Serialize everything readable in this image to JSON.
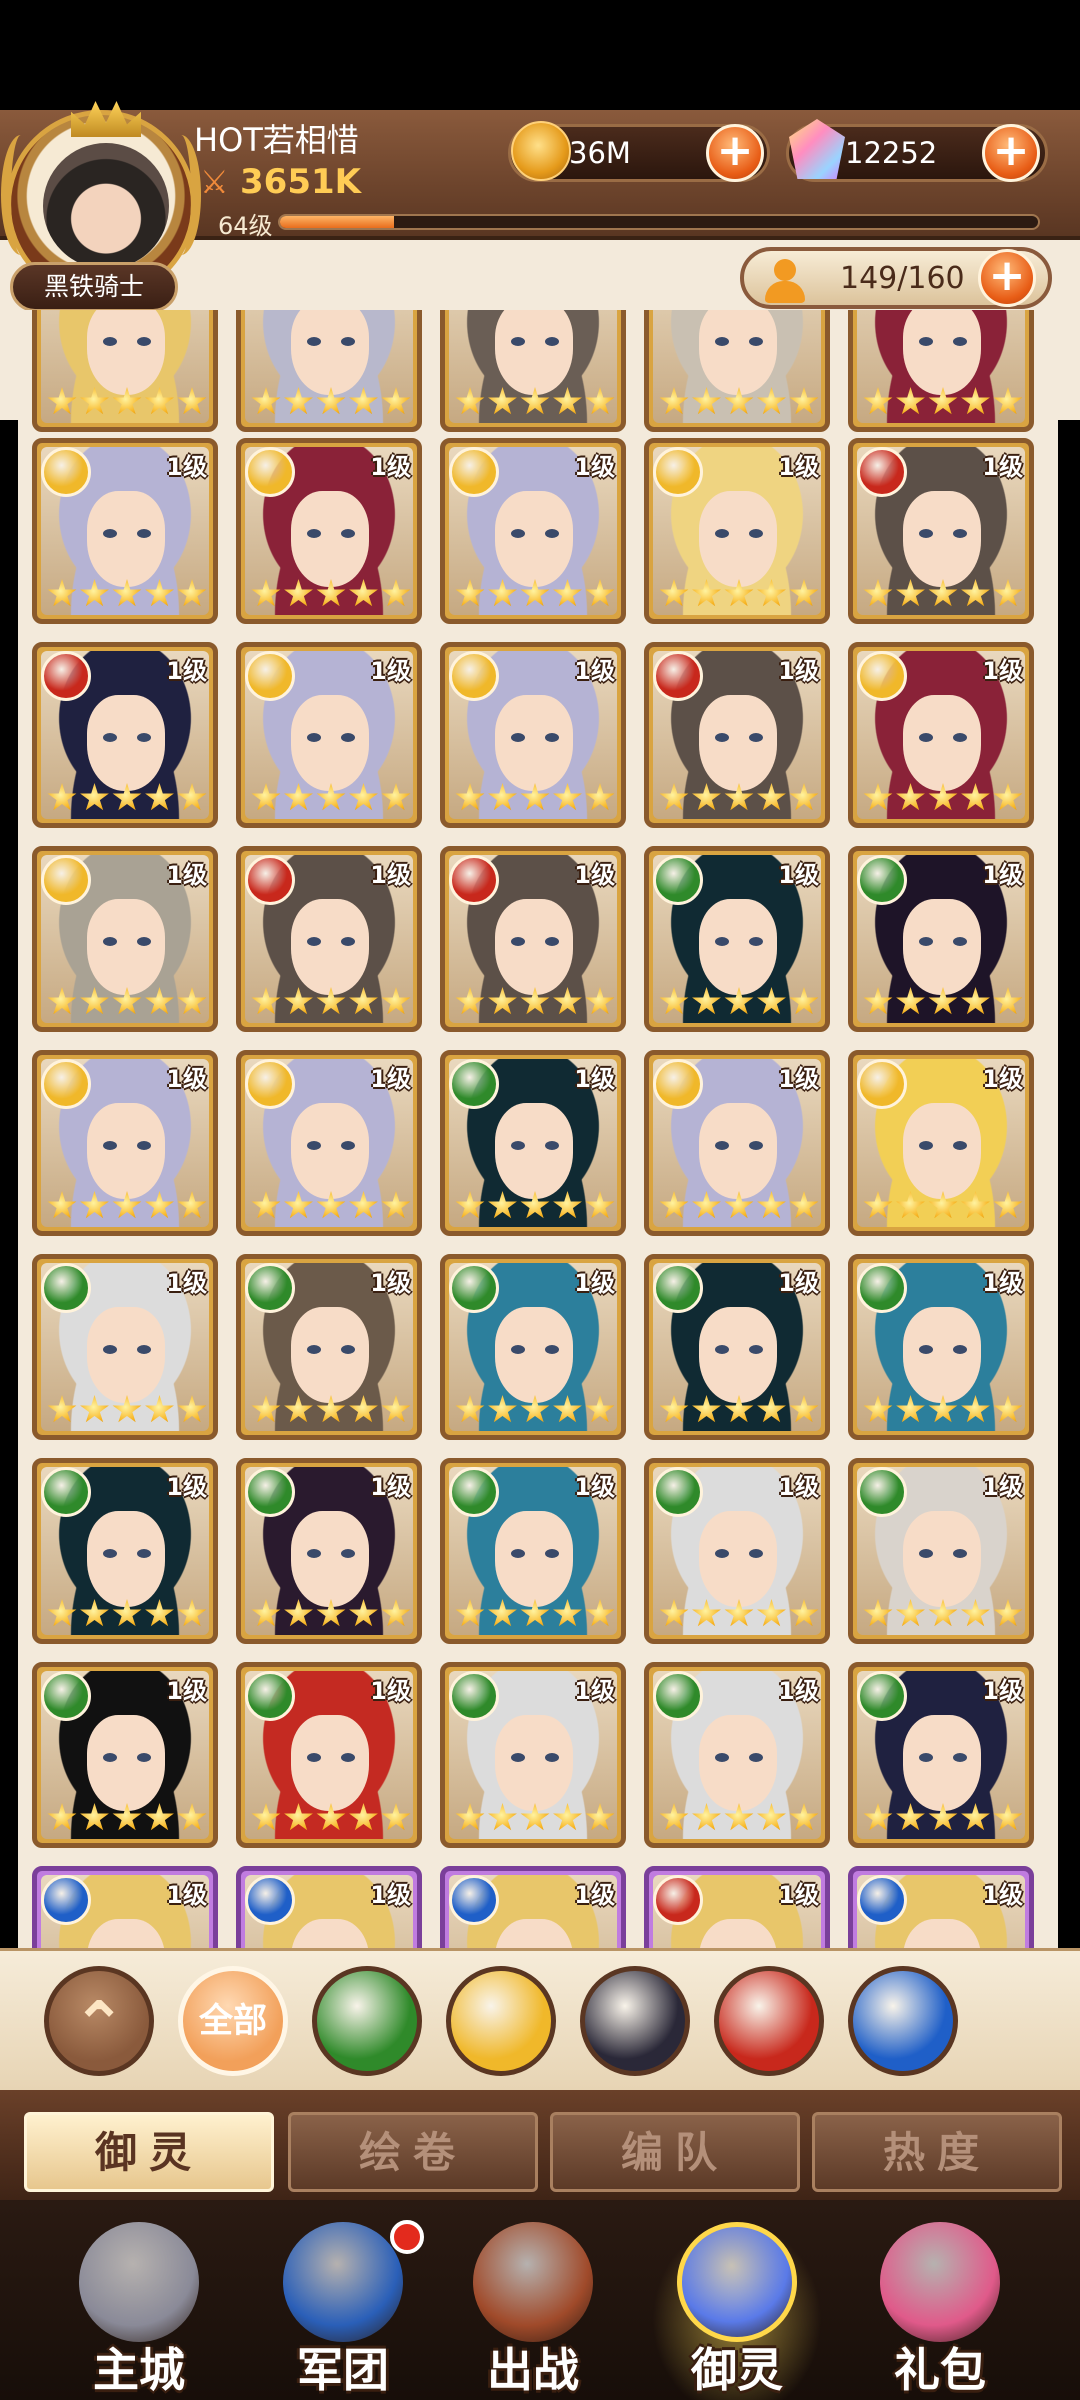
{
  "header": {
    "player_name": "HOT若相惜",
    "power": "3651K",
    "level": "64级",
    "xp_fraction": 0.15,
    "title_badge": "黑铁骑士",
    "gold": "36M",
    "gems": "12252",
    "roster": "149/160",
    "icons": {
      "power": "crossed-swords-icon",
      "gold": "gold-coin-icon",
      "gems": "crystal-gem-icon",
      "roster": "person-icon",
      "add": "plus-icon"
    }
  },
  "heroes": [
    {
      "row": 0,
      "col": 0,
      "faction": "",
      "level": "",
      "stars": 5,
      "partial": true,
      "hair": "#e8c66a"
    },
    {
      "row": 0,
      "col": 1,
      "faction": "",
      "level": "",
      "stars": 5,
      "partial": true,
      "hair": "#b8b8cc"
    },
    {
      "row": 0,
      "col": 2,
      "faction": "",
      "level": "",
      "stars": 5,
      "partial": true,
      "hair": "#6a5e55"
    },
    {
      "row": 0,
      "col": 3,
      "faction": "",
      "level": "",
      "stars": 5,
      "partial": true,
      "hair": "#c9c0b2"
    },
    {
      "row": 0,
      "col": 4,
      "faction": "",
      "level": "",
      "stars": 5,
      "partial": true,
      "hair": "#8a2238"
    },
    {
      "row": 1,
      "col": 0,
      "faction": "gold",
      "level": "1级",
      "stars": 5,
      "hair": "#b5b3d4"
    },
    {
      "row": 1,
      "col": 1,
      "faction": "gold",
      "level": "1级",
      "stars": 5,
      "hair": "#8a2238"
    },
    {
      "row": 1,
      "col": 2,
      "faction": "gold",
      "level": "1级",
      "stars": 5,
      "hair": "#b5b3d4"
    },
    {
      "row": 1,
      "col": 3,
      "faction": "gold",
      "level": "1级",
      "stars": 5,
      "hair": "#efd481"
    },
    {
      "row": 1,
      "col": 4,
      "faction": "red",
      "level": "1级",
      "stars": 5,
      "hair": "#5c5048"
    },
    {
      "row": 2,
      "col": 0,
      "faction": "red",
      "level": "1级",
      "stars": 5,
      "hair": "#1f2140"
    },
    {
      "row": 2,
      "col": 1,
      "faction": "gold",
      "level": "1级",
      "stars": 5,
      "hair": "#b5b3d4"
    },
    {
      "row": 2,
      "col": 2,
      "faction": "gold",
      "level": "1级",
      "stars": 5,
      "hair": "#b5b3d4"
    },
    {
      "row": 2,
      "col": 3,
      "faction": "red",
      "level": "1级",
      "stars": 5,
      "hair": "#5c5048"
    },
    {
      "row": 2,
      "col": 4,
      "faction": "gold",
      "level": "1级",
      "stars": 5,
      "hair": "#8a2238"
    },
    {
      "row": 3,
      "col": 0,
      "faction": "gold",
      "level": "1级",
      "stars": 5,
      "hair": "#a9a294"
    },
    {
      "row": 3,
      "col": 1,
      "faction": "red",
      "level": "1级",
      "stars": 5,
      "hair": "#5c5048"
    },
    {
      "row": 3,
      "col": 2,
      "faction": "red",
      "level": "1级",
      "stars": 5,
      "hair": "#5c5048"
    },
    {
      "row": 3,
      "col": 3,
      "faction": "green",
      "level": "1级",
      "stars": 5,
      "hair": "#102a33"
    },
    {
      "row": 3,
      "col": 4,
      "faction": "green",
      "level": "1级",
      "stars": 5,
      "hair": "#1e1428"
    },
    {
      "row": 4,
      "col": 0,
      "faction": "gold",
      "level": "1级",
      "stars": 5,
      "hair": "#b5b3d4"
    },
    {
      "row": 4,
      "col": 1,
      "faction": "gold",
      "level": "1级",
      "stars": 5,
      "hair": "#b5b3d4"
    },
    {
      "row": 4,
      "col": 2,
      "faction": "green",
      "level": "1级",
      "stars": 5,
      "hair": "#102a33"
    },
    {
      "row": 4,
      "col": 3,
      "faction": "gold",
      "level": "1级",
      "stars": 5,
      "hair": "#b5b3d4"
    },
    {
      "row": 4,
      "col": 4,
      "faction": "gold",
      "level": "1级",
      "stars": 5,
      "hair": "#f2cf55"
    },
    {
      "row": 5,
      "col": 0,
      "faction": "green",
      "level": "1级",
      "stars": 5,
      "hair": "#dcdcdc"
    },
    {
      "row": 5,
      "col": 1,
      "faction": "green",
      "level": "1级",
      "stars": 5,
      "hair": "#6b5a4a"
    },
    {
      "row": 5,
      "col": 2,
      "faction": "green",
      "level": "1级",
      "stars": 5,
      "hair": "#2c7f9c"
    },
    {
      "row": 5,
      "col": 3,
      "faction": "green",
      "level": "1级",
      "stars": 5,
      "hair": "#102a33"
    },
    {
      "row": 5,
      "col": 4,
      "faction": "green",
      "level": "1级",
      "stars": 5,
      "hair": "#2c7f9c"
    },
    {
      "row": 6,
      "col": 0,
      "faction": "green",
      "level": "1级",
      "stars": 5,
      "hair": "#102a33"
    },
    {
      "row": 6,
      "col": 1,
      "faction": "green",
      "level": "1级",
      "stars": 5,
      "hair": "#2a1a2e"
    },
    {
      "row": 6,
      "col": 2,
      "faction": "green",
      "level": "1级",
      "stars": 5,
      "hair": "#2c7f9c"
    },
    {
      "row": 6,
      "col": 3,
      "faction": "green",
      "level": "1级",
      "stars": 5,
      "hair": "#dcdcdc"
    },
    {
      "row": 6,
      "col": 4,
      "faction": "green",
      "level": "1级",
      "stars": 5,
      "hair": "#d9d3cc"
    },
    {
      "row": 7,
      "col": 0,
      "faction": "green",
      "level": "1级",
      "stars": 5,
      "hair": "#111111"
    },
    {
      "row": 7,
      "col": 1,
      "faction": "green",
      "level": "1级",
      "stars": 5,
      "hair": "#c42a22"
    },
    {
      "row": 7,
      "col": 2,
      "faction": "green",
      "level": "1级",
      "stars": 5,
      "hair": "#dcdcdc"
    },
    {
      "row": 7,
      "col": 3,
      "faction": "green",
      "level": "1级",
      "stars": 5,
      "hair": "#dcdcdc"
    },
    {
      "row": 7,
      "col": 4,
      "faction": "green",
      "level": "1级",
      "stars": 5,
      "hair": "#1f2140"
    },
    {
      "row": 8,
      "col": 0,
      "faction": "blue",
      "level": "1级",
      "stars": 0,
      "purple": true,
      "hair": "#e8c66a"
    },
    {
      "row": 8,
      "col": 1,
      "faction": "blue",
      "level": "1级",
      "stars": 0,
      "purple": true,
      "hair": "#e8c66a"
    },
    {
      "row": 8,
      "col": 2,
      "faction": "blue",
      "level": "1级",
      "stars": 0,
      "purple": true,
      "hair": "#e8c66a"
    },
    {
      "row": 8,
      "col": 3,
      "faction": "red",
      "level": "1级",
      "stars": 0,
      "purple": true,
      "hair": "#e8c66a"
    },
    {
      "row": 8,
      "col": 4,
      "faction": "blue",
      "level": "1级",
      "stars": 0,
      "purple": true,
      "hair": "#e8c66a"
    }
  ],
  "filters": [
    {
      "id": "collapse",
      "label": "",
      "icon": "double-chevron-up-icon",
      "color": "#8a5a3c"
    },
    {
      "id": "all",
      "label": "全部",
      "icon": "",
      "color": "#f2a05a"
    },
    {
      "id": "nature",
      "label": "",
      "icon": "green-dragon-faction-icon",
      "color": "#2f8a2a"
    },
    {
      "id": "light",
      "label": "",
      "icon": "gold-rose-faction-icon",
      "color": "#f0b82a"
    },
    {
      "id": "dark",
      "label": "",
      "icon": "dark-star-faction-icon",
      "color": "#2a2838"
    },
    {
      "id": "fire",
      "label": "",
      "icon": "red-phoenix-faction-icon",
      "color": "#c8281c"
    },
    {
      "id": "water",
      "label": "",
      "icon": "blue-wave-faction-icon",
      "color": "#1f5fc8"
    }
  ],
  "faction_colors": {
    "gold": "#f0b82a",
    "red": "#c8281c",
    "green": "#2f8a2a",
    "blue": "#1f5fc8"
  },
  "tabs": [
    {
      "label": "御灵",
      "active": true
    },
    {
      "label": "绘卷",
      "active": false
    },
    {
      "label": "编队",
      "active": false
    },
    {
      "label": "热度",
      "active": false
    }
  ],
  "nav": [
    {
      "label": "主城",
      "icon": "castle-icon",
      "active": false,
      "notify": false,
      "color": "#8a8a98"
    },
    {
      "label": "军团",
      "icon": "guild-fist-icon",
      "active": false,
      "notify": true,
      "color": "#2a5fb8"
    },
    {
      "label": "出战",
      "icon": "battle-gate-icon",
      "active": false,
      "notify": false,
      "color": "#a04a2a"
    },
    {
      "label": "御灵",
      "icon": "spirit-crystal-icon",
      "active": true,
      "notify": false,
      "color": "#5a7ae8"
    },
    {
      "label": "礼包",
      "icon": "gift-shop-icon",
      "active": false,
      "notify": false,
      "color": "#e05a8a"
    }
  ]
}
